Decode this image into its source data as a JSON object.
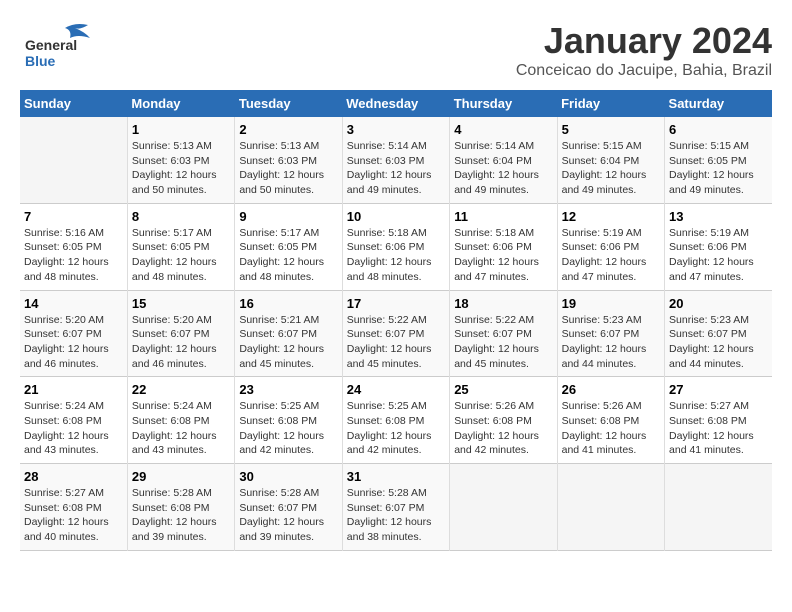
{
  "logo": {
    "line1": "General",
    "line2": "Blue"
  },
  "title": "January 2024",
  "subtitle": "Conceicao do Jacuipe, Bahia, Brazil",
  "headers": [
    "Sunday",
    "Monday",
    "Tuesday",
    "Wednesday",
    "Thursday",
    "Friday",
    "Saturday"
  ],
  "weeks": [
    [
      {
        "day": "",
        "info": ""
      },
      {
        "day": "1",
        "info": "Sunrise: 5:13 AM\nSunset: 6:03 PM\nDaylight: 12 hours\nand 50 minutes."
      },
      {
        "day": "2",
        "info": "Sunrise: 5:13 AM\nSunset: 6:03 PM\nDaylight: 12 hours\nand 50 minutes."
      },
      {
        "day": "3",
        "info": "Sunrise: 5:14 AM\nSunset: 6:03 PM\nDaylight: 12 hours\nand 49 minutes."
      },
      {
        "day": "4",
        "info": "Sunrise: 5:14 AM\nSunset: 6:04 PM\nDaylight: 12 hours\nand 49 minutes."
      },
      {
        "day": "5",
        "info": "Sunrise: 5:15 AM\nSunset: 6:04 PM\nDaylight: 12 hours\nand 49 minutes."
      },
      {
        "day": "6",
        "info": "Sunrise: 5:15 AM\nSunset: 6:05 PM\nDaylight: 12 hours\nand 49 minutes."
      }
    ],
    [
      {
        "day": "7",
        "info": "Sunrise: 5:16 AM\nSunset: 6:05 PM\nDaylight: 12 hours\nand 48 minutes."
      },
      {
        "day": "8",
        "info": "Sunrise: 5:17 AM\nSunset: 6:05 PM\nDaylight: 12 hours\nand 48 minutes."
      },
      {
        "day": "9",
        "info": "Sunrise: 5:17 AM\nSunset: 6:05 PM\nDaylight: 12 hours\nand 48 minutes."
      },
      {
        "day": "10",
        "info": "Sunrise: 5:18 AM\nSunset: 6:06 PM\nDaylight: 12 hours\nand 48 minutes."
      },
      {
        "day": "11",
        "info": "Sunrise: 5:18 AM\nSunset: 6:06 PM\nDaylight: 12 hours\nand 47 minutes."
      },
      {
        "day": "12",
        "info": "Sunrise: 5:19 AM\nSunset: 6:06 PM\nDaylight: 12 hours\nand 47 minutes."
      },
      {
        "day": "13",
        "info": "Sunrise: 5:19 AM\nSunset: 6:06 PM\nDaylight: 12 hours\nand 47 minutes."
      }
    ],
    [
      {
        "day": "14",
        "info": "Sunrise: 5:20 AM\nSunset: 6:07 PM\nDaylight: 12 hours\nand 46 minutes."
      },
      {
        "day": "15",
        "info": "Sunrise: 5:20 AM\nSunset: 6:07 PM\nDaylight: 12 hours\nand 46 minutes."
      },
      {
        "day": "16",
        "info": "Sunrise: 5:21 AM\nSunset: 6:07 PM\nDaylight: 12 hours\nand 45 minutes."
      },
      {
        "day": "17",
        "info": "Sunrise: 5:22 AM\nSunset: 6:07 PM\nDaylight: 12 hours\nand 45 minutes."
      },
      {
        "day": "18",
        "info": "Sunrise: 5:22 AM\nSunset: 6:07 PM\nDaylight: 12 hours\nand 45 minutes."
      },
      {
        "day": "19",
        "info": "Sunrise: 5:23 AM\nSunset: 6:07 PM\nDaylight: 12 hours\nand 44 minutes."
      },
      {
        "day": "20",
        "info": "Sunrise: 5:23 AM\nSunset: 6:07 PM\nDaylight: 12 hours\nand 44 minutes."
      }
    ],
    [
      {
        "day": "21",
        "info": "Sunrise: 5:24 AM\nSunset: 6:08 PM\nDaylight: 12 hours\nand 43 minutes."
      },
      {
        "day": "22",
        "info": "Sunrise: 5:24 AM\nSunset: 6:08 PM\nDaylight: 12 hours\nand 43 minutes."
      },
      {
        "day": "23",
        "info": "Sunrise: 5:25 AM\nSunset: 6:08 PM\nDaylight: 12 hours\nand 42 minutes."
      },
      {
        "day": "24",
        "info": "Sunrise: 5:25 AM\nSunset: 6:08 PM\nDaylight: 12 hours\nand 42 minutes."
      },
      {
        "day": "25",
        "info": "Sunrise: 5:26 AM\nSunset: 6:08 PM\nDaylight: 12 hours\nand 42 minutes."
      },
      {
        "day": "26",
        "info": "Sunrise: 5:26 AM\nSunset: 6:08 PM\nDaylight: 12 hours\nand 41 minutes."
      },
      {
        "day": "27",
        "info": "Sunrise: 5:27 AM\nSunset: 6:08 PM\nDaylight: 12 hours\nand 41 minutes."
      }
    ],
    [
      {
        "day": "28",
        "info": "Sunrise: 5:27 AM\nSunset: 6:08 PM\nDaylight: 12 hours\nand 40 minutes."
      },
      {
        "day": "29",
        "info": "Sunrise: 5:28 AM\nSunset: 6:08 PM\nDaylight: 12 hours\nand 39 minutes."
      },
      {
        "day": "30",
        "info": "Sunrise: 5:28 AM\nSunset: 6:07 PM\nDaylight: 12 hours\nand 39 minutes."
      },
      {
        "day": "31",
        "info": "Sunrise: 5:28 AM\nSunset: 6:07 PM\nDaylight: 12 hours\nand 38 minutes."
      },
      {
        "day": "",
        "info": ""
      },
      {
        "day": "",
        "info": ""
      },
      {
        "day": "",
        "info": ""
      }
    ]
  ]
}
